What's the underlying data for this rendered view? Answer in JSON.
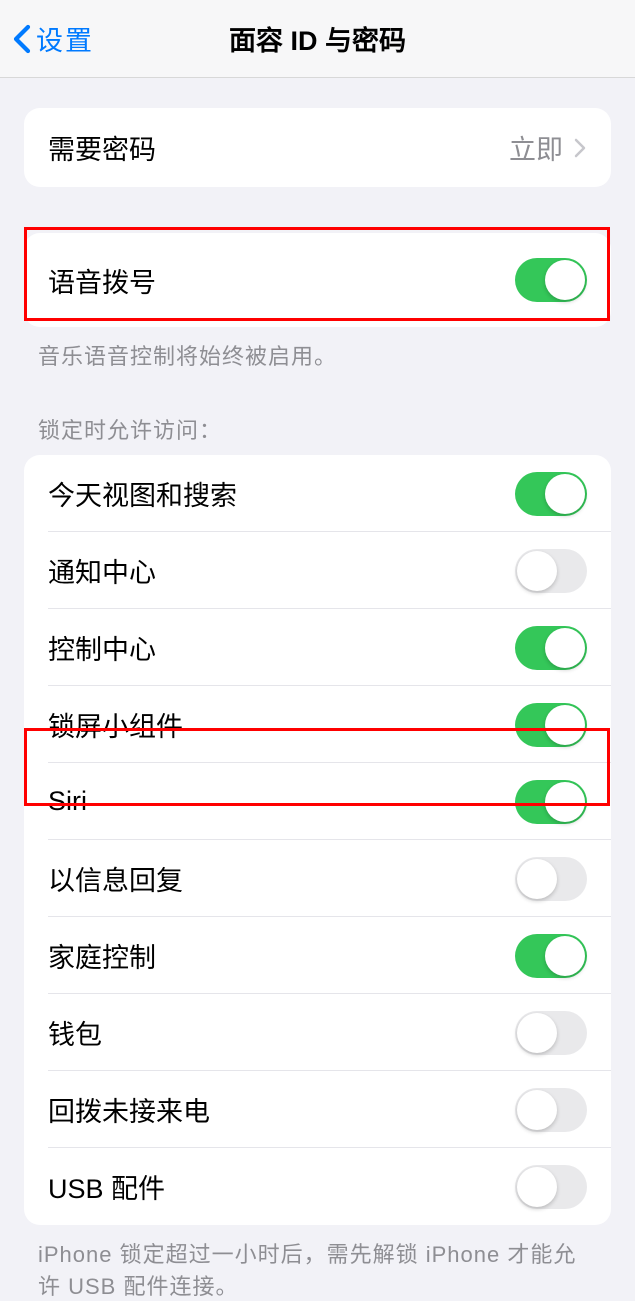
{
  "nav": {
    "back_label": "设置",
    "title": "面容 ID 与密码"
  },
  "passcode_group": {
    "require_passcode_label": "需要密码",
    "require_passcode_value": "立即"
  },
  "voice_dial": {
    "label": "语音拨号",
    "enabled": true,
    "footer": "音乐语音控制将始终被启用。"
  },
  "lock_access": {
    "header": "锁定时允许访问：",
    "items": [
      {
        "label": "今天视图和搜索",
        "enabled": true
      },
      {
        "label": "通知中心",
        "enabled": false
      },
      {
        "label": "控制中心",
        "enabled": true
      },
      {
        "label": "锁屏小组件",
        "enabled": true
      },
      {
        "label": "Siri",
        "enabled": true
      },
      {
        "label": "以信息回复",
        "enabled": false
      },
      {
        "label": "家庭控制",
        "enabled": true
      },
      {
        "label": "钱包",
        "enabled": false
      },
      {
        "label": "回拨未接来电",
        "enabled": false
      },
      {
        "label": "USB 配件",
        "enabled": false
      }
    ],
    "footer": "iPhone 锁定超过一小时后，需先解锁 iPhone 才能允许 USB 配件连接。"
  }
}
